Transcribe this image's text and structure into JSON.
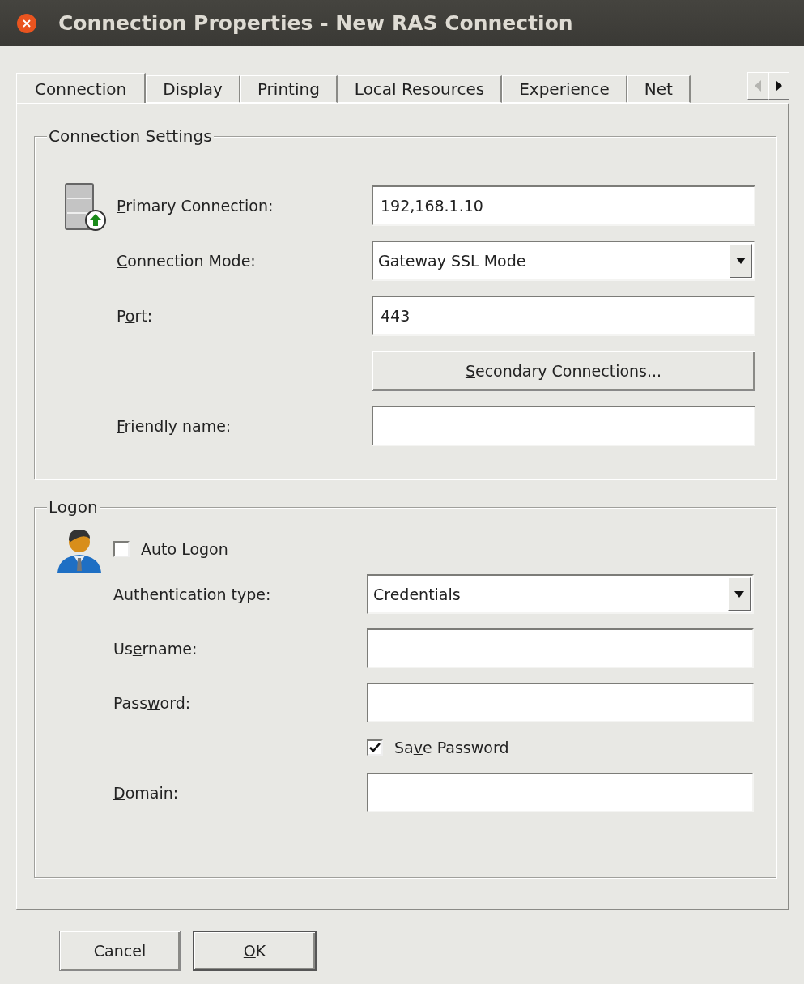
{
  "window": {
    "title": "Connection Properties - New RAS Connection"
  },
  "tabs": [
    {
      "label": "Connection",
      "selected": true
    },
    {
      "label": "Display",
      "selected": false
    },
    {
      "label": "Printing",
      "selected": false
    },
    {
      "label": "Local Resources",
      "selected": false
    },
    {
      "label": "Experience",
      "selected": false
    },
    {
      "label": "Net",
      "selected": false
    }
  ],
  "tab_scroll": {
    "left_disabled": true,
    "right_disabled": false
  },
  "sections": [
    {
      "title": "Connection Settings",
      "rows": [
        {
          "kind": "text",
          "label": [
            {
              "text": "P",
              "underlined": true
            },
            {
              "text": "rimary Connection:",
              "underlined": false
            }
          ],
          "value": "192,168.1.10"
        },
        {
          "kind": "dropdown",
          "label": [
            {
              "text": "C",
              "underlined": true
            },
            {
              "text": "onnection Mode:",
              "underlined": false
            }
          ],
          "value": "Gateway SSL Mode"
        },
        {
          "kind": "text",
          "label": [
            {
              "text": "P",
              "underlined": false
            },
            {
              "text": "o",
              "underlined": true
            },
            {
              "text": "rt:",
              "underlined": false
            }
          ],
          "value": "443"
        },
        {
          "kind": "button",
          "label": [
            {
              "text": "S",
              "underlined": true
            },
            {
              "text": "econdary Connections...",
              "underlined": false
            }
          ]
        },
        {
          "kind": "text",
          "label": [
            {
              "text": "F",
              "underlined": true
            },
            {
              "text": "riendly name:",
              "underlined": false
            }
          ]
        }
      ]
    },
    {
      "title": "Logon",
      "rows": [
        {
          "kind": "label_checkbox",
          "label": [
            {
              "text": "Auto ",
              "underlined": false
            },
            {
              "text": "L",
              "underlined": true
            },
            {
              "text": "ogon",
              "underlined": false
            }
          ],
          "checked": false
        },
        {
          "kind": "dropdown",
          "label": [
            {
              "text": "Authentication type:",
              "underlined": false
            }
          ],
          "value": "Credentials"
        },
        {
          "kind": "text",
          "label": [
            {
              "text": "Us",
              "underlined": false
            },
            {
              "text": "e",
              "underlined": true
            },
            {
              "text": "rname:",
              "underlined": false
            }
          ]
        },
        {
          "kind": "text",
          "label": [
            {
              "text": "Pass",
              "underlined": false
            },
            {
              "text": "w",
              "underlined": true
            },
            {
              "text": "ord:",
              "underlined": false
            }
          ]
        },
        {
          "kind": "checkbox",
          "label": [
            {
              "text": "Sa",
              "underlined": false
            },
            {
              "text": "v",
              "underlined": true
            },
            {
              "text": "e Password",
              "underlined": false
            }
          ],
          "checked": true
        },
        {
          "kind": "text",
          "label": [
            {
              "text": "D",
              "underlined": true
            },
            {
              "text": "omain:",
              "underlined": false
            }
          ]
        }
      ]
    }
  ],
  "buttons": [
    {
      "label": [
        {
          "text": "Cancel",
          "underlined": false
        }
      ],
      "default": false
    },
    {
      "label": [
        {
          "text": "O",
          "underlined": true
        },
        {
          "text": "K",
          "underlined": false
        }
      ],
      "default": true
    }
  ]
}
